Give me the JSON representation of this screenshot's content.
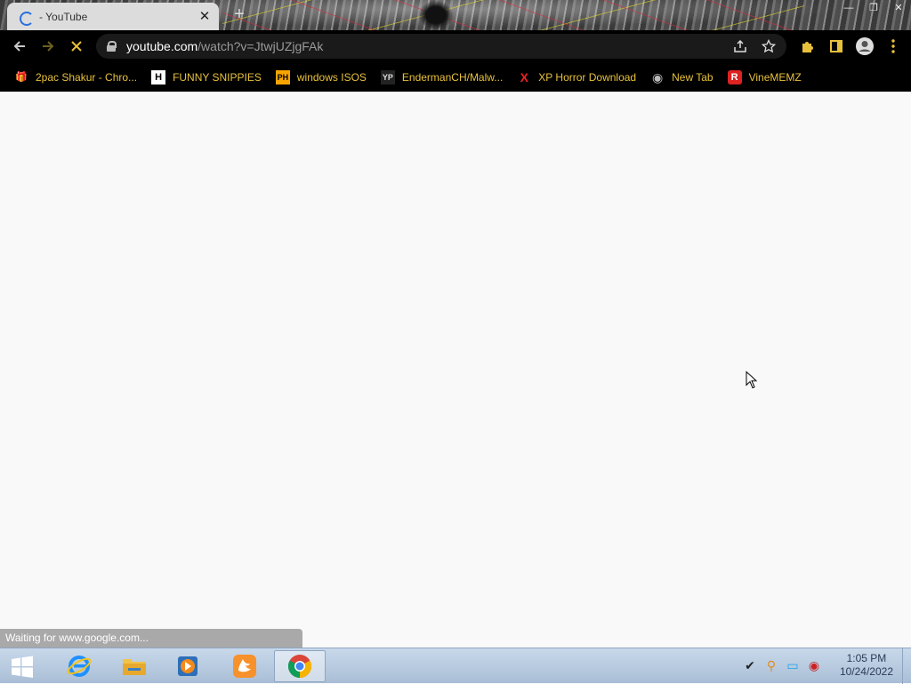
{
  "tab": {
    "title": "- YouTube",
    "close": "✕"
  },
  "window": {
    "minimize": "—",
    "restore": "❐",
    "close": "✕"
  },
  "new_tab": "+",
  "toolbar": {
    "back": "←",
    "forward": "→",
    "stop": "✕"
  },
  "omnibox": {
    "host": "youtube.com",
    "path": "/watch?v=JtwjUZjgFAk"
  },
  "bookmarks": [
    {
      "label": "2pac Shakur - Chro...",
      "icon": "🎁",
      "icon_color": "#e33"
    },
    {
      "label": "FUNNY SNIPPIES",
      "icon": "H",
      "icon_color": "#fff"
    },
    {
      "label": "windows ISOS",
      "icon": "PH",
      "icon_color": "#f7a400"
    },
    {
      "label": "EndermanCH/Malw...",
      "icon": "YP",
      "icon_color": "#888"
    },
    {
      "label": "XP Horror Download",
      "icon": "X",
      "icon_color": "#e22"
    },
    {
      "label": "New Tab",
      "icon": "◉",
      "icon_color": "#aaa"
    },
    {
      "label": "VineMEMZ",
      "icon": "R",
      "icon_color": "#d22"
    }
  ],
  "status": {
    "text": "Waiting for www.google.com..."
  },
  "taskbar": {
    "apps": [
      "internet-explorer",
      "file-explorer",
      "media-player",
      "uc-browser",
      "chrome"
    ]
  },
  "clock": {
    "time": "1:05 PM",
    "date": "10/24/2022"
  },
  "colors": {
    "accent_bookmark": "#e8c13c",
    "toolbar_bg": "#000000",
    "content_bg": "#f9f9f9"
  }
}
